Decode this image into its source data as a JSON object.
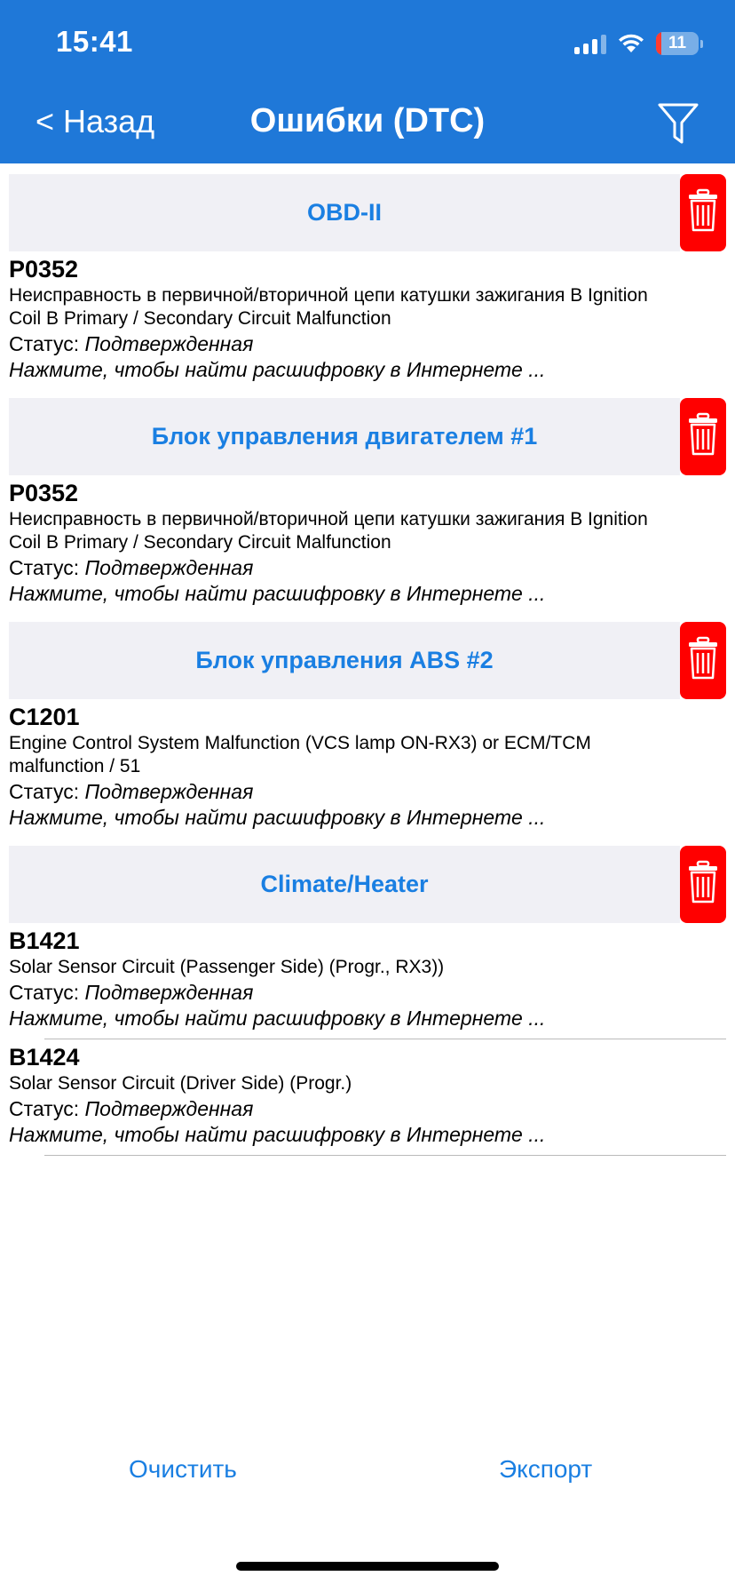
{
  "status_bar": {
    "time": "15:41",
    "battery": "11"
  },
  "nav": {
    "back_label": "< Назад",
    "title": "Ошибки (DTC)",
    "filter_icon": "filter-funnel-icon"
  },
  "status_label": "Статус: ",
  "sections": [
    {
      "title": "OBD-II",
      "items": [
        {
          "code": "P0352",
          "description": "Неисправность в первичной/вторичной цепи катушки зажигания B Ignition Coil B Primary / Secondary Circuit Malfunction",
          "status": "Подтвержденная",
          "hint": "Нажмите, чтобы найти расшифровку в Интернете ..."
        }
      ]
    },
    {
      "title": "Блок управления двигателем #1",
      "items": [
        {
          "code": "P0352",
          "description": "Неисправность в первичной/вторичной цепи катушки зажигания B Ignition Coil B Primary / Secondary Circuit Malfunction",
          "status": "Подтвержденная",
          "hint": "Нажмите, чтобы найти расшифровку в Интернете ..."
        }
      ]
    },
    {
      "title": "Блок управления ABS #2",
      "items": [
        {
          "code": "C1201",
          "description": "Engine Control System Malfunction (VCS lamp ON-RX3) or ECM/TCM malfunction / 51",
          "status": "Подтвержденная",
          "hint": "Нажмите, чтобы найти расшифровку в Интернете ..."
        }
      ]
    },
    {
      "title": "Climate/Heater",
      "items": [
        {
          "code": "B1421",
          "description": "Solar Sensor Circuit (Passenger Side) (Progr., RX3))",
          "status": "Подтвержденная",
          "hint": "Нажмите, чтобы найти расшифровку в Интернете ..."
        },
        {
          "code": "B1424",
          "description": "Solar Sensor Circuit (Driver Side) (Progr.)",
          "status": "Подтвержденная",
          "hint": "Нажмите, чтобы найти расшифровку в Интернете ..."
        }
      ]
    }
  ],
  "toolbar": {
    "clear_label": "Очистить",
    "export_label": "Экспорт"
  },
  "colors": {
    "header_bg": "#1f78d8",
    "accent": "#1a7fe2",
    "delete": "#ff0000",
    "section_bg": "#f0f0f5"
  }
}
